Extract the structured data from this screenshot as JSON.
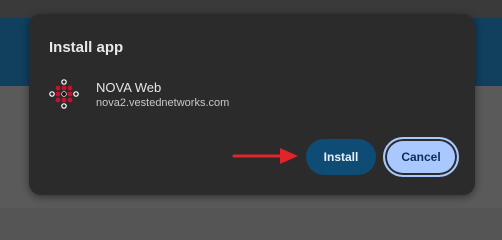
{
  "dialog": {
    "title": "Install app",
    "app_name": "NOVA Web",
    "app_url": "nova2.vestednetworks.com",
    "install_label": "Install",
    "cancel_label": "Cancel"
  },
  "icons": {
    "app": "nova-logo-icon",
    "annotation": "red-arrow-icon"
  },
  "colors": {
    "dialog_bg": "#2b2b2b",
    "install_bg": "#0f4c75",
    "cancel_bg": "#a8c8ff",
    "arrow": "#e0242a",
    "page_header": "#113f5e"
  }
}
